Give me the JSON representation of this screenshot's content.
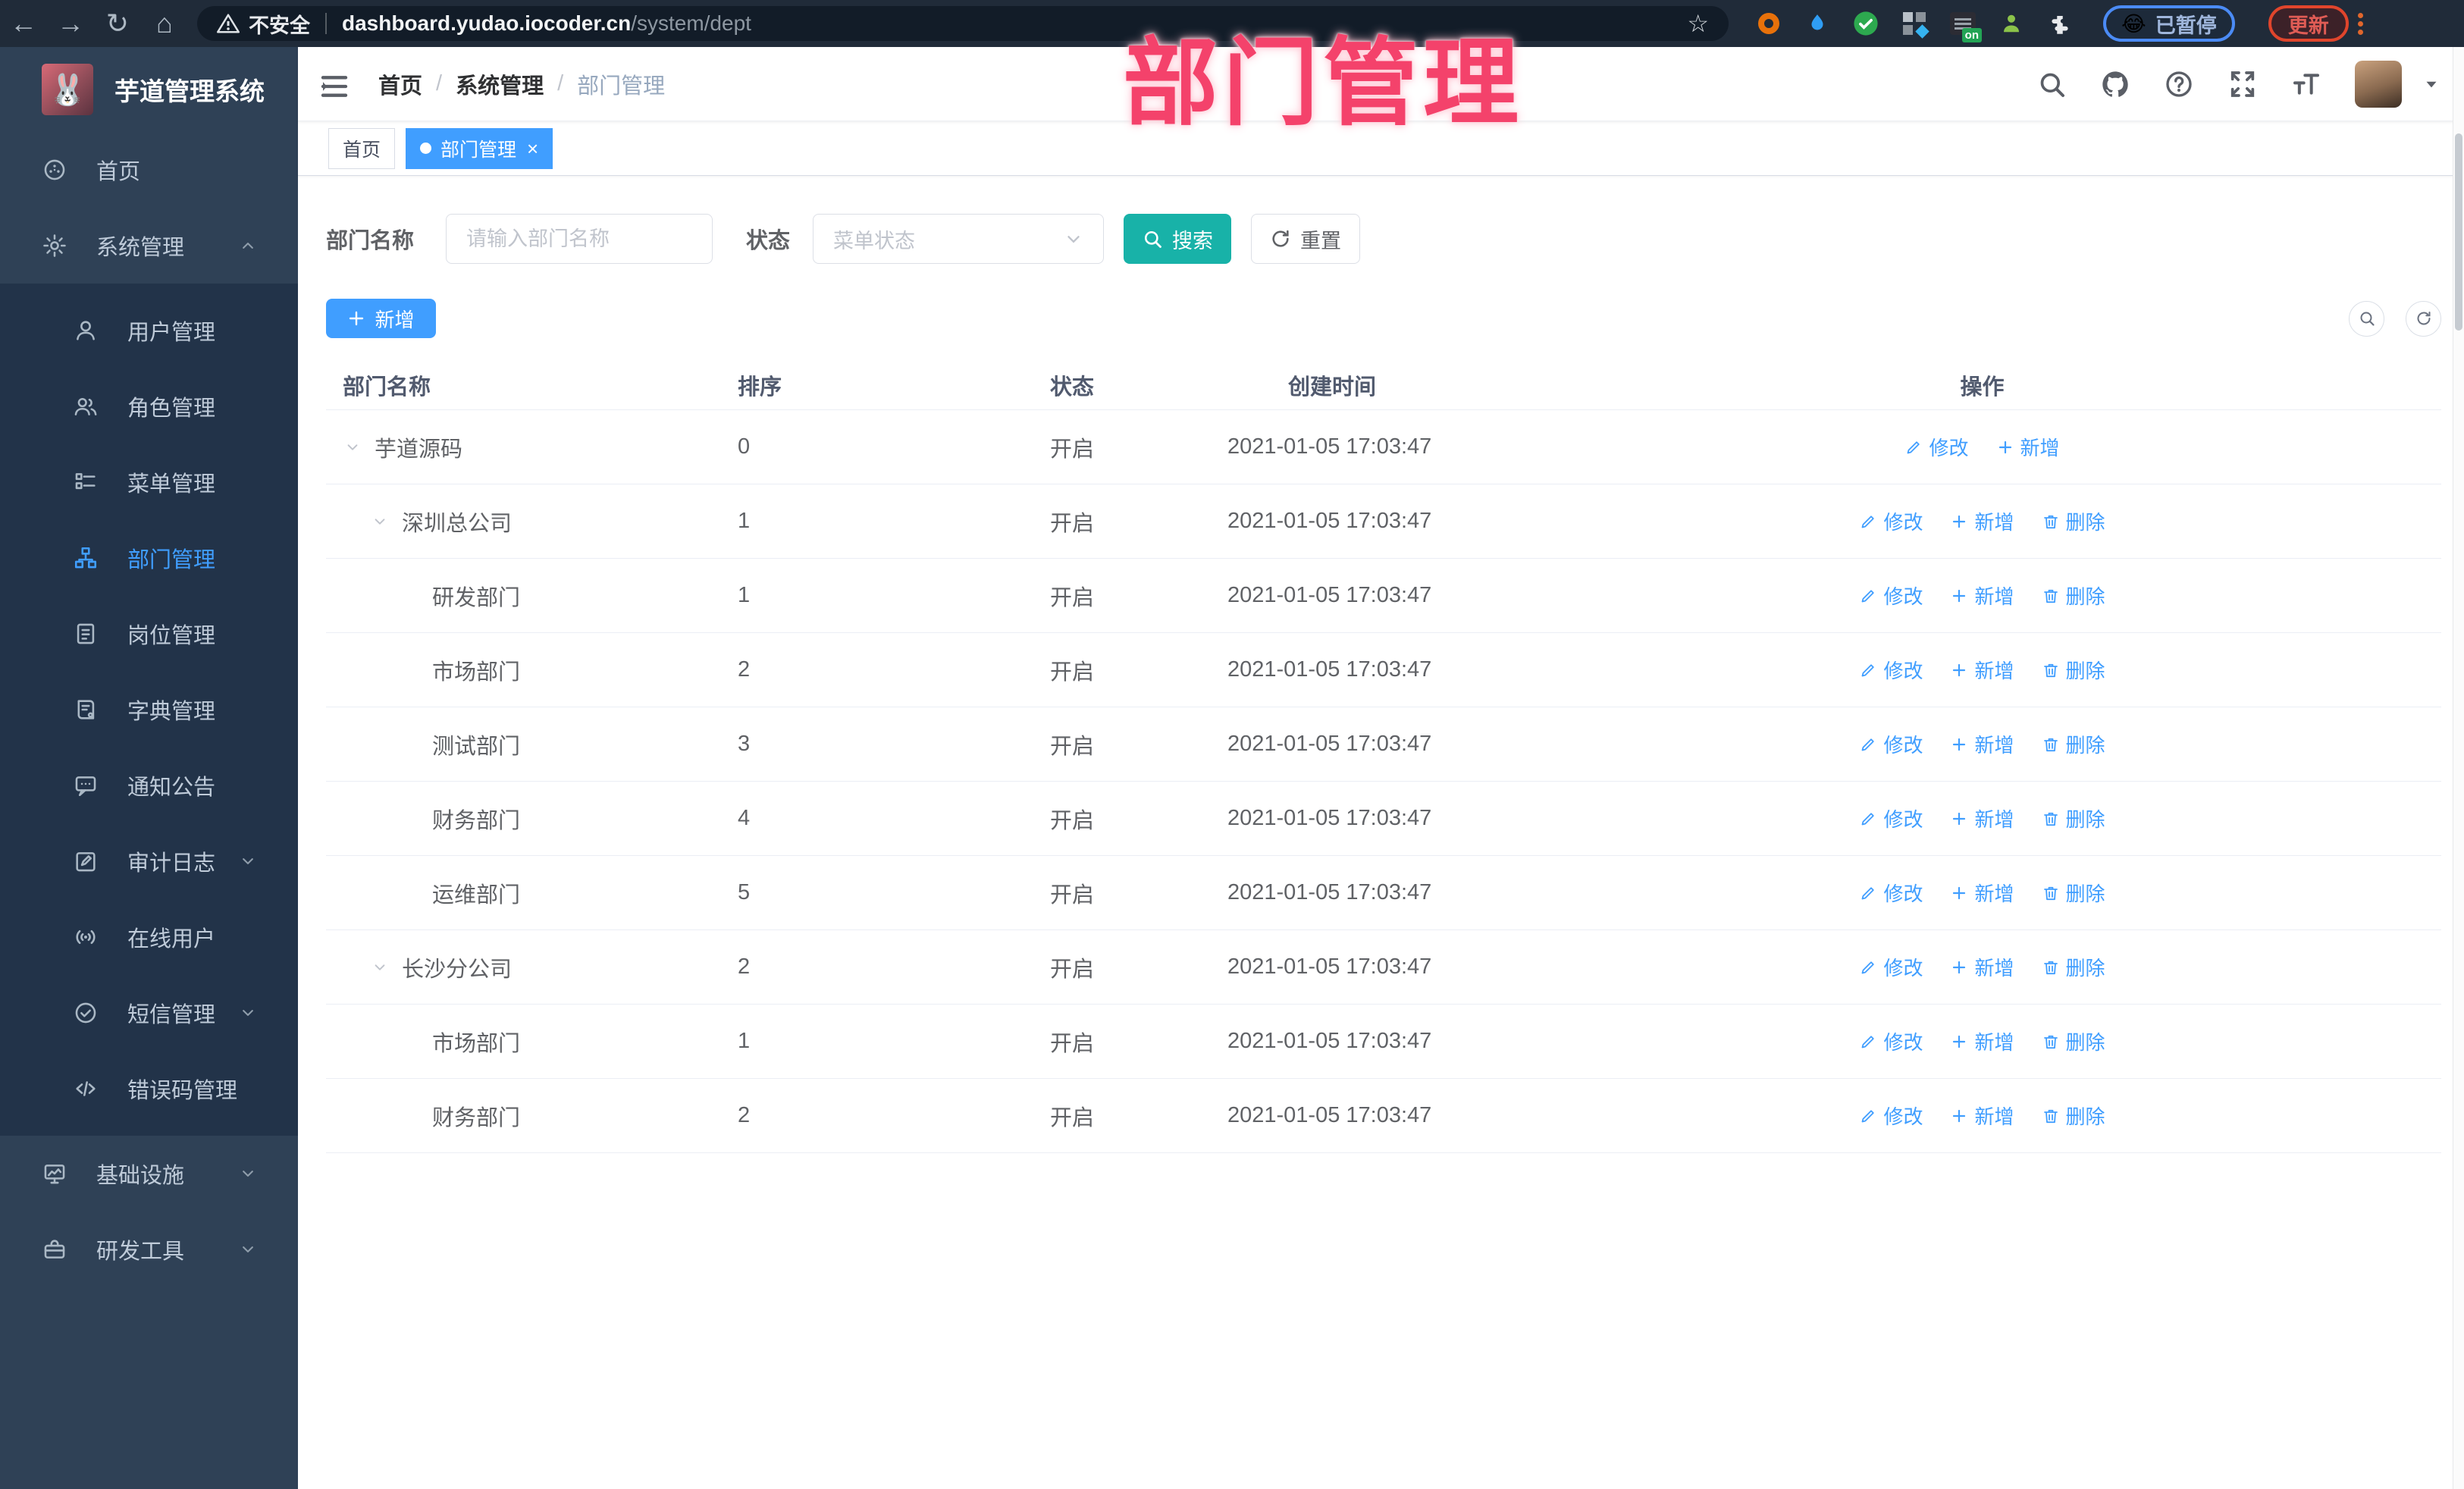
{
  "browser": {
    "security_label": "不安全",
    "url_host": "dashboard.yudao.iocoder.cn",
    "url_path": "/system/dept",
    "paused_badge": "已暂停",
    "paused_emoji": "😂",
    "update_button": "更新",
    "extension_on_badge": "on"
  },
  "overlay_title": "部门管理",
  "sidebar": {
    "logo_title": "芋道管理系统",
    "logo_glyph": "🐰",
    "items": [
      {
        "label": "首页",
        "icon": "home",
        "level": 0
      },
      {
        "label": "系统管理",
        "icon": "gear",
        "level": 0,
        "chevron": "up"
      },
      {
        "label": "用户管理",
        "icon": "user",
        "level": 1
      },
      {
        "label": "角色管理",
        "icon": "roles",
        "level": 1
      },
      {
        "label": "菜单管理",
        "icon": "menulist",
        "level": 1
      },
      {
        "label": "部门管理",
        "icon": "tree",
        "level": 1,
        "active": true
      },
      {
        "label": "岗位管理",
        "icon": "badge",
        "level": 1
      },
      {
        "label": "字典管理",
        "icon": "dict",
        "level": 1
      },
      {
        "label": "通知公告",
        "icon": "message",
        "level": 1
      },
      {
        "label": "审计日志",
        "icon": "log",
        "level": 1,
        "chevron": "down"
      },
      {
        "label": "在线用户",
        "icon": "online",
        "level": 1
      },
      {
        "label": "短信管理",
        "icon": "sms",
        "level": 1,
        "chevron": "down"
      },
      {
        "label": "错误码管理",
        "icon": "code",
        "level": 1
      },
      {
        "label": "基础设施",
        "icon": "infra",
        "level": 0,
        "chevron": "down"
      },
      {
        "label": "研发工具",
        "icon": "tools",
        "level": 0,
        "chevron": "down"
      }
    ]
  },
  "header": {
    "breadcrumb": [
      "首页",
      "系统管理",
      "部门管理"
    ]
  },
  "tabs": [
    {
      "label": "首页",
      "active": false,
      "closable": false
    },
    {
      "label": "部门管理",
      "active": true,
      "closable": true
    }
  ],
  "filters": {
    "name_label": "部门名称",
    "name_placeholder": "请输入部门名称",
    "status_label": "状态",
    "status_placeholder": "菜单状态",
    "search_button": "搜索",
    "reset_button": "重置"
  },
  "toolbar": {
    "add_button": "新增"
  },
  "table": {
    "columns": [
      "部门名称",
      "排序",
      "状态",
      "创建时间",
      "操作"
    ],
    "rows": [
      {
        "name": "芋道源码",
        "indent": 0,
        "caret": true,
        "sort": "0",
        "status": "开启",
        "time": "2021-01-05 17:03:47",
        "actions": [
          {
            "label": "修改",
            "type": "edit"
          },
          {
            "label": "新增",
            "type": "add"
          }
        ]
      },
      {
        "name": "深圳总公司",
        "indent": 1,
        "caret": true,
        "sort": "1",
        "status": "开启",
        "time": "2021-01-05 17:03:47",
        "actions": [
          {
            "label": "修改",
            "type": "edit"
          },
          {
            "label": "新增",
            "type": "add"
          },
          {
            "label": "删除",
            "type": "delete"
          }
        ]
      },
      {
        "name": "研发部门",
        "indent": 2,
        "caret": false,
        "sort": "1",
        "status": "开启",
        "time": "2021-01-05 17:03:47",
        "actions": [
          {
            "label": "修改",
            "type": "edit"
          },
          {
            "label": "新增",
            "type": "add"
          },
          {
            "label": "删除",
            "type": "delete"
          }
        ]
      },
      {
        "name": "市场部门",
        "indent": 2,
        "caret": false,
        "sort": "2",
        "status": "开启",
        "time": "2021-01-05 17:03:47",
        "actions": [
          {
            "label": "修改",
            "type": "edit"
          },
          {
            "label": "新增",
            "type": "add"
          },
          {
            "label": "删除",
            "type": "delete"
          }
        ]
      },
      {
        "name": "测试部门",
        "indent": 2,
        "caret": false,
        "sort": "3",
        "status": "开启",
        "time": "2021-01-05 17:03:47",
        "actions": [
          {
            "label": "修改",
            "type": "edit"
          },
          {
            "label": "新增",
            "type": "add"
          },
          {
            "label": "删除",
            "type": "delete"
          }
        ]
      },
      {
        "name": "财务部门",
        "indent": 2,
        "caret": false,
        "sort": "4",
        "status": "开启",
        "time": "2021-01-05 17:03:47",
        "actions": [
          {
            "label": "修改",
            "type": "edit"
          },
          {
            "label": "新增",
            "type": "add"
          },
          {
            "label": "删除",
            "type": "delete"
          }
        ]
      },
      {
        "name": "运维部门",
        "indent": 2,
        "caret": false,
        "sort": "5",
        "status": "开启",
        "time": "2021-01-05 17:03:47",
        "actions": [
          {
            "label": "修改",
            "type": "edit"
          },
          {
            "label": "新增",
            "type": "add"
          },
          {
            "label": "删除",
            "type": "delete"
          }
        ]
      },
      {
        "name": "长沙分公司",
        "indent": 1,
        "caret": true,
        "sort": "2",
        "status": "开启",
        "time": "2021-01-05 17:03:47",
        "actions": [
          {
            "label": "修改",
            "type": "edit"
          },
          {
            "label": "新增",
            "type": "add"
          },
          {
            "label": "删除",
            "type": "delete"
          }
        ]
      },
      {
        "name": "市场部门",
        "indent": 2,
        "caret": false,
        "sort": "1",
        "status": "开启",
        "time": "2021-01-05 17:03:47",
        "actions": [
          {
            "label": "修改",
            "type": "edit"
          },
          {
            "label": "新增",
            "type": "add"
          },
          {
            "label": "删除",
            "type": "delete"
          }
        ]
      },
      {
        "name": "财务部门",
        "indent": 2,
        "caret": false,
        "sort": "2",
        "status": "开启",
        "time": "2021-01-05 17:03:47",
        "actions": [
          {
            "label": "修改",
            "type": "edit"
          },
          {
            "label": "新增",
            "type": "add"
          },
          {
            "label": "删除",
            "type": "delete"
          }
        ]
      }
    ]
  },
  "colors": {
    "primary_blue": "#409eff",
    "search_teal": "#18b2a8",
    "overlay_pink": "#f4426b",
    "sidebar_bg": "#2f4156",
    "submenu_bg": "#223349",
    "browser_bar": "#202b39",
    "table_text": "#606266",
    "header_text": "#515a6e"
  }
}
